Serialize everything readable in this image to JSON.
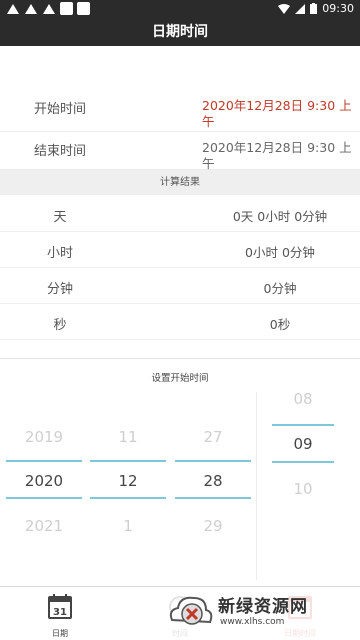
{
  "status_bar": {
    "time": "09:30"
  },
  "app_bar": {
    "title": "日期时间"
  },
  "range": {
    "start_label": "开始时间",
    "start_value": "2020年12月28日 9:30 上午",
    "end_label": "结束时间",
    "end_value": "2020年12月28日 9:30 上午"
  },
  "results": {
    "header": "计算结果",
    "rows": [
      {
        "label": "天",
        "value": "0天 0小时 0分钟"
      },
      {
        "label": "小时",
        "value": "0小时 0分钟"
      },
      {
        "label": "分钟",
        "value": "0分钟"
      },
      {
        "label": "秒",
        "value": "0秒"
      }
    ]
  },
  "picker": {
    "title": "设置开始时间",
    "year": {
      "prev": "2019",
      "selected": "2020",
      "next": "2021"
    },
    "month": {
      "prev": "11",
      "selected": "12",
      "next": "1"
    },
    "day": {
      "prev": "27",
      "selected": "28",
      "next": "29"
    },
    "hour": {
      "prev": "08",
      "selected": "09",
      "next": "10"
    }
  },
  "tabs": [
    {
      "label": "日期",
      "icon": "calendar-icon",
      "badge": "31"
    },
    {
      "label": "时间",
      "icon": "clock-icon"
    },
    {
      "label": "日期时间",
      "icon": "calendar-clock-icon"
    }
  ],
  "watermark": {
    "title": "新绿资源网",
    "url": "www.xlhs.com"
  },
  "colors": {
    "accent_red": "#c0392b",
    "picker_line": "#7fc7d8",
    "bar_dark": "#2b2b2b"
  }
}
